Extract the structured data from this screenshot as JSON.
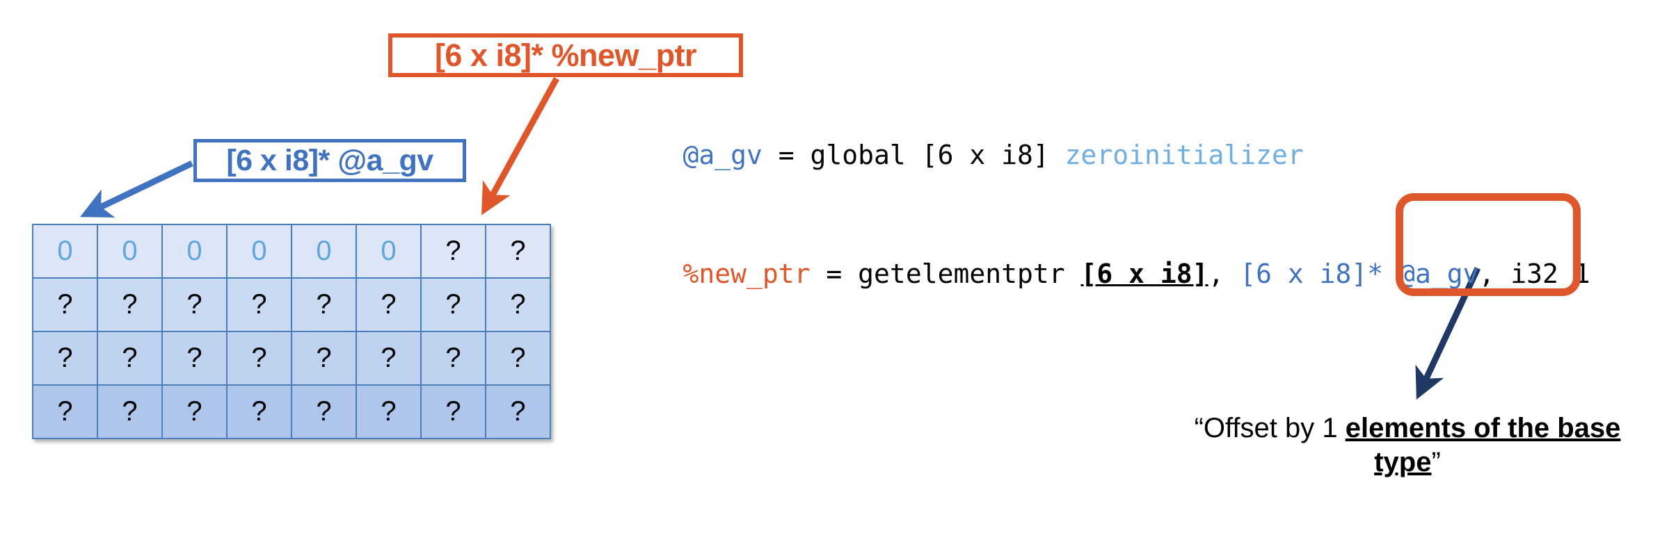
{
  "callouts": {
    "new_ptr": {
      "label": "[6 x i8]* %new_ptr",
      "color": "#E0562B"
    },
    "a_gv": {
      "label": "[6 x i8]* @a_gv",
      "color": "#3F72BF"
    }
  },
  "highlight": {
    "name": "offset-highlight",
    "color": "#E0562B",
    "targets": ", i32 1"
  },
  "arrows": [
    {
      "name": "arrow-a-gv-to-grid",
      "color": "#3F72BF",
      "from": "[6 x i8]* @a_gv box",
      "to": "grid cell row1 col1"
    },
    {
      "name": "arrow-new-ptr-to-grid",
      "color": "#E0562B",
      "from": "[6 x i8]* %new_ptr box",
      "to": "grid cell row1 col7"
    },
    {
      "name": "arrow-offset-to-caption",
      "color": "#1F3864",
      "from": "offset highlight",
      "to": "offset caption"
    }
  ],
  "code": {
    "line1": [
      {
        "text": "@a_gv",
        "style": "blue"
      },
      {
        "text": " = global [6 x i8] ",
        "style": "black"
      },
      {
        "text": "zeroinitializer",
        "style": "light-blue"
      }
    ],
    "line2": [
      {
        "text": "%new_ptr",
        "style": "orange"
      },
      {
        "text": " = getelementptr ",
        "style": "black"
      },
      {
        "text": "[6 x i8]",
        "style": "bold-underline"
      },
      {
        "text": ", ",
        "style": "black"
      },
      {
        "text": "[6 x i8]* @a_gv",
        "style": "blue"
      },
      {
        "text": ", i32 1",
        "style": "black"
      }
    ]
  },
  "grid": {
    "name": "memory-grid",
    "rows": 4,
    "cols": 8,
    "cells": [
      [
        "0",
        "0",
        "0",
        "0",
        "0",
        "0",
        "?",
        "?"
      ],
      [
        "?",
        "?",
        "?",
        "?",
        "?",
        "?",
        "?",
        "?"
      ],
      [
        "?",
        "?",
        "?",
        "?",
        "?",
        "?",
        "?",
        "?"
      ],
      [
        "?",
        "?",
        "?",
        "?",
        "?",
        "?",
        "?",
        "?"
      ]
    ],
    "zero_color": "#60A5DC",
    "unknown_color": "#000000",
    "border_color": "#4A7EBB"
  },
  "caption": {
    "open_quote": "“Offset by 1 ",
    "emphasis": "elements of the base type",
    "close_quote": "”"
  }
}
